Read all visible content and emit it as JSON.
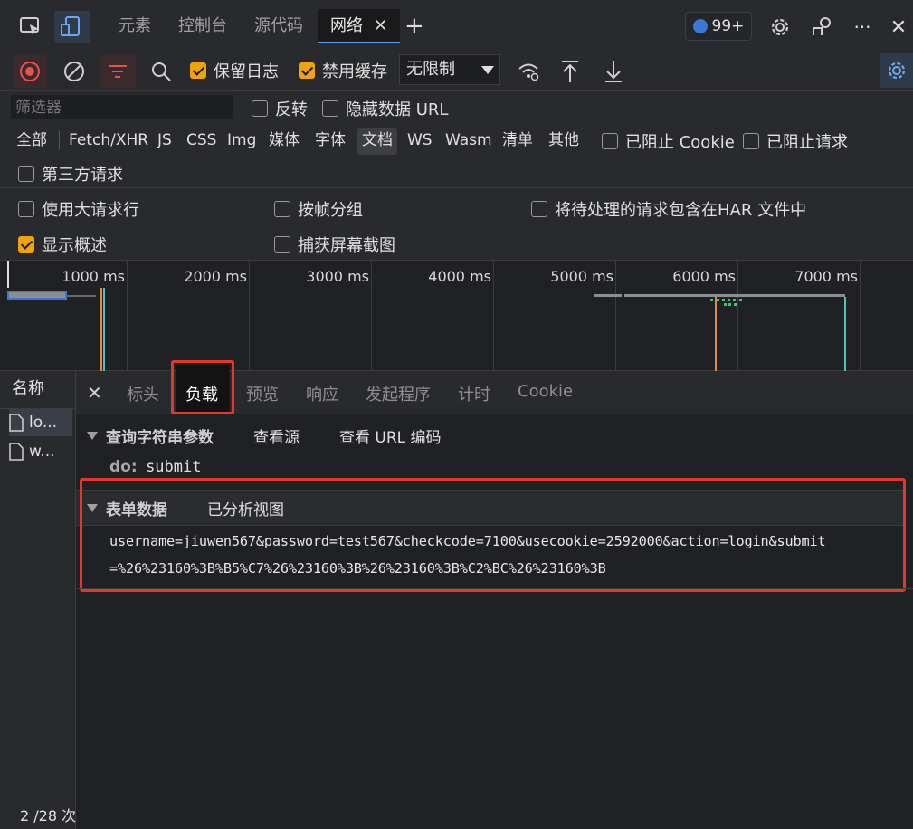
{
  "top_tabs": {
    "elements": "元素",
    "console": "控制台",
    "sources": "源代码",
    "network": "网络",
    "close": "✕",
    "add": "+",
    "badge_count": "99+",
    "more": "···",
    "close_devtools": "✕"
  },
  "toolbar": {
    "preserve_log": "保留日志",
    "disable_cache": "禁用缓存",
    "throttle_value": "无限制"
  },
  "filter": {
    "placeholder": "筛选器",
    "invert": "反转",
    "hide_data_url": "隐藏数据 URL",
    "types": [
      "全部",
      "Fetch/XHR",
      "JS",
      "CSS",
      "Img",
      "媒体",
      "字体",
      "文档",
      "WS",
      "Wasm",
      "清单",
      "其他"
    ],
    "blocked_cookies": "已阻止 Cookie",
    "blocked_requests": "已阻止请求",
    "third_party": "第三方请求"
  },
  "options": {
    "big_request_rows": "使用大请求行",
    "group_by_frame": "按帧分组",
    "include_pending_har": "将待处理的请求包含在HAR 文件中",
    "show_overview": "显示概述",
    "capture_screenshots": "捕获屏幕截图"
  },
  "overview": {
    "ticks": [
      "1000 ms",
      "2000 ms",
      "3000 ms",
      "4000 ms",
      "5000 ms",
      "6000 ms",
      "7000 ms"
    ]
  },
  "requests": {
    "header": "名称",
    "rows": [
      "lo...",
      "w..."
    ],
    "footer": "2 /28 次"
  },
  "detail": {
    "close": "✕",
    "tabs": [
      "标头",
      "负载",
      "预览",
      "响应",
      "发起程序",
      "计时",
      "Cookie"
    ],
    "query_section": {
      "title": "查询字符串参数",
      "view_source": "查看源",
      "view_url_encoded": "查看 URL 编码",
      "param_key": "do:",
      "param_value": "submit"
    },
    "form_section": {
      "title": "表单数据",
      "view_parsed": "已分析视图",
      "line1": "username=jiuwen567&password=test567&checkcode=7100&usecookie=2592000&action=login&submit",
      "line2": "=%26%23160%3B%B5%C7%26%23160%3B%26%23160%3B%C2%BC%26%23160%3B"
    }
  },
  "colors": {
    "accent_orange": "#f0a30a",
    "highlight_red": "#e5362a",
    "record_red": "#e5534b"
  }
}
